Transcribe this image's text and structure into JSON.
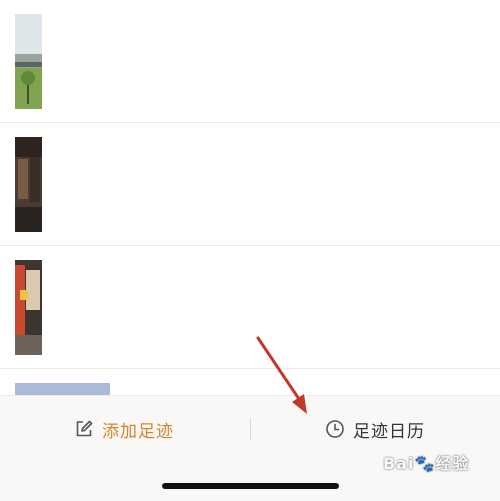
{
  "footprints": [
    {
      "thumbnail": "bridge-landscape-photo"
    },
    {
      "thumbnail": "old-street-building-photo"
    },
    {
      "thumbnail": "restaurant-table-photo"
    },
    {
      "thumbnail": "sky-photo"
    }
  ],
  "toolbar": {
    "add_label": "添加足迹",
    "add_icon": "edit-icon",
    "calendar_label": "足迹日历",
    "calendar_icon": "clock-icon",
    "accent_color": "#d4862f"
  },
  "annotation": {
    "color": "#c0392b"
  },
  "watermark": "Bai🐾经验"
}
